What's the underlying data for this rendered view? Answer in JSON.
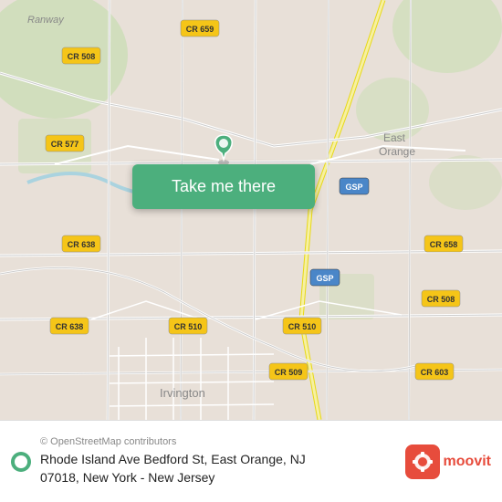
{
  "map": {
    "center_lat": 40.765,
    "center_lng": -74.22,
    "zoom": 13
  },
  "button": {
    "label": "Take me there"
  },
  "attribution": {
    "text": "© OpenStreetMap contributors"
  },
  "address": {
    "line1": "Rhode Island Ave Bedford St, East Orange, NJ",
    "line2": "07018, New York - New Jersey"
  },
  "moovit": {
    "brand": "moovit",
    "color": "#e74c3c"
  },
  "colors": {
    "button_bg": "#4caf7d",
    "road_major": "#ffffff",
    "road_minor": "#f5f5ef",
    "land": "#e8e0d8",
    "green_area": "#c8ddb2",
    "water": "#aad3df",
    "road_stroke": "#cccccc",
    "route_label_bg": "#f5c518",
    "route_label_text": "#333"
  }
}
